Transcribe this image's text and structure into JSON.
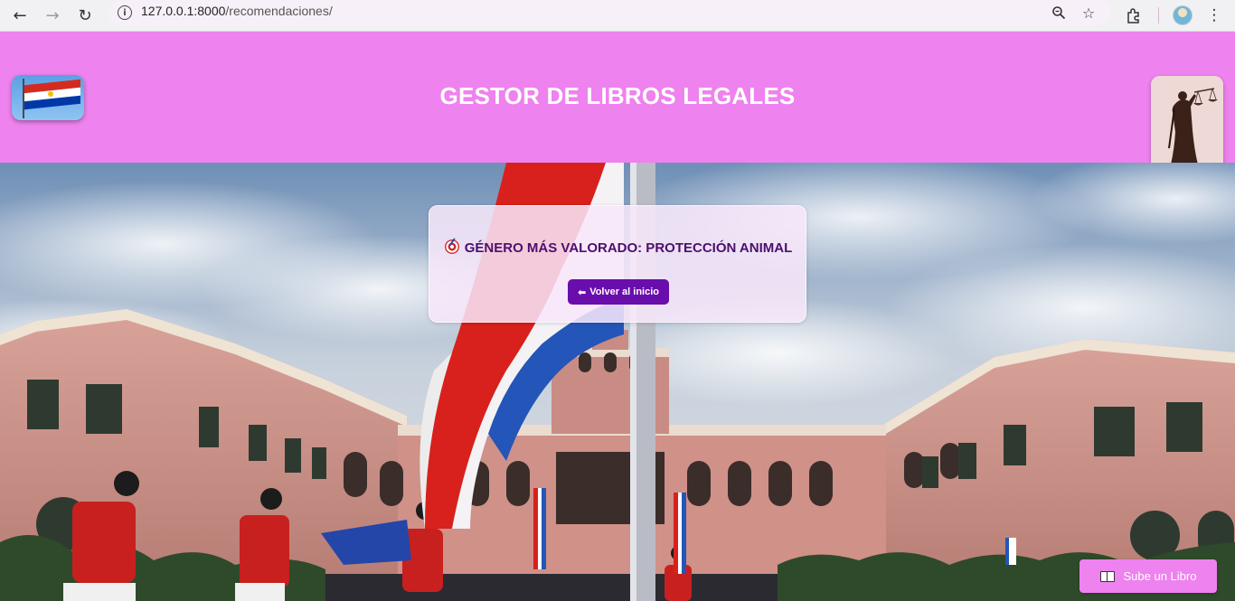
{
  "browser": {
    "url_host": "127.0.0.1:8000",
    "url_path": "/recomendaciones/",
    "icons": [
      "back-arrow-icon",
      "forward-arrow-icon",
      "reload-icon",
      "site-info-icon",
      "zoom-icon",
      "bookmark-star-icon",
      "extensions-icon",
      "profile-avatar",
      "menu-kebab-icon"
    ],
    "glyphs": {
      "back": "←",
      "forward": "→",
      "reload": "↻",
      "info": "i",
      "zoom": "🔍",
      "star": "☆",
      "extensions": "⧉",
      "menu": "⋮"
    }
  },
  "header": {
    "title": "GESTOR DE LIBROS LEGALES",
    "background_color": "#ee82ee"
  },
  "card": {
    "genre_text": "GÉNERO MÁS VALORADO: PROTECCIÓN ANIMAL",
    "back_button_arrow": "⬅",
    "back_button_label": "Volver al inicio",
    "button_color": "#6a0dad",
    "text_color": "#4b0f6e"
  },
  "upload": {
    "label": "Sube un Libro"
  }
}
